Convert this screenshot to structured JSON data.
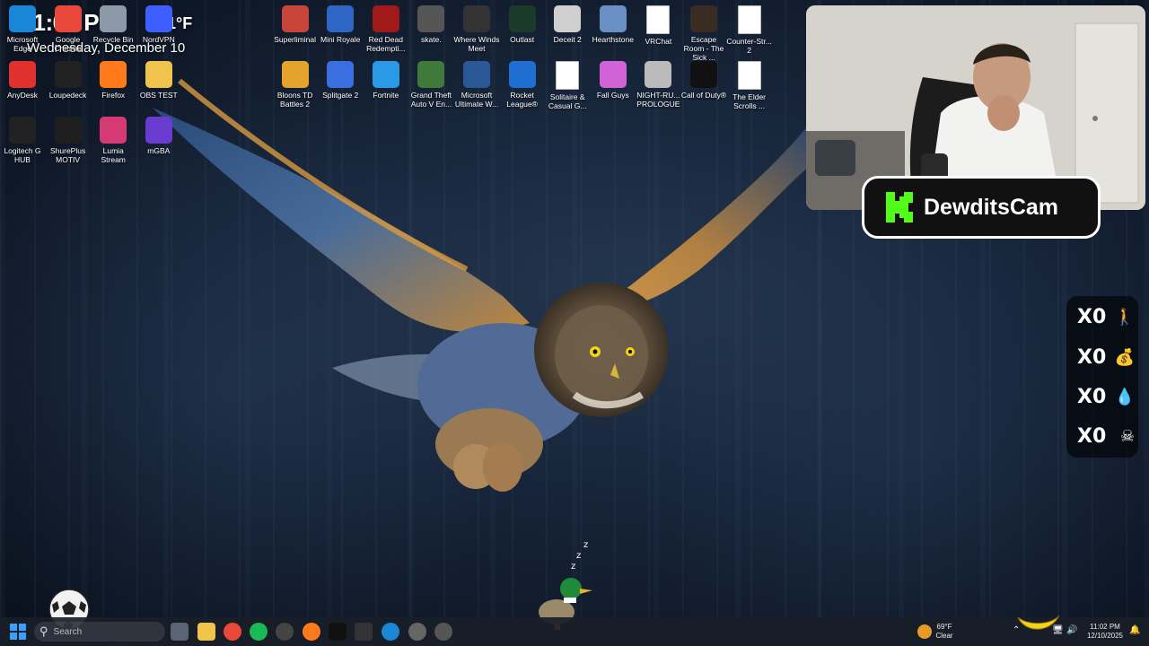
{
  "widget": {
    "time": "11:02 PM",
    "temperature": "51°F",
    "date": "Wednesday, December 10"
  },
  "desktop_icons": [
    {
      "label": "Microsoft Edge",
      "icon": "edge-icon",
      "color": "#1a86d8"
    },
    {
      "label": "Google Chrome",
      "icon": "chrome-icon",
      "color": "#e9483a"
    },
    {
      "label": "Recycle Bin",
      "icon": "recycle-bin-icon",
      "color": "#8c9aa8"
    },
    {
      "label": "NordVPN",
      "icon": "nordvpn-icon",
      "color": "#3e5fff"
    },
    {
      "label": "Superliminal",
      "icon": "superliminal-icon",
      "color": "#c8453c"
    },
    {
      "label": "Mini Royale",
      "icon": "mini-royale-icon",
      "color": "#2f66c6"
    },
    {
      "label": "Red Dead Redempti...",
      "icon": "red-dead-icon",
      "color": "#a01a1a"
    },
    {
      "label": "skate.",
      "icon": "skate-icon",
      "color": "#555555"
    },
    {
      "label": "Where Winds Meet",
      "icon": "where-winds-meet-icon",
      "color": "#333333"
    },
    {
      "label": "Outlast",
      "icon": "outlast-icon",
      "color": "#1b3b2a"
    },
    {
      "label": "Deceit 2",
      "icon": "deceit-icon",
      "color": "#cfcfcf"
    },
    {
      "label": "Hearthstone",
      "icon": "hearthstone-icon",
      "color": "#6a8fc2"
    },
    {
      "label": "VRChat",
      "icon": "file-icon",
      "color": "#ffffff"
    },
    {
      "label": "Escape Room - The Sick ...",
      "icon": "escape-room-icon",
      "color": "#3a2b23"
    },
    {
      "label": "Counter-Str... 2",
      "icon": "file-icon",
      "color": "#ffffff"
    },
    {
      "label": "AnyDesk",
      "icon": "anydesk-icon",
      "color": "#e1312f"
    },
    {
      "label": "Loupedeck",
      "icon": "loupedeck-icon",
      "color": "#222222"
    },
    {
      "label": "Firefox",
      "icon": "firefox-icon",
      "color": "#ff7a1a"
    },
    {
      "label": "OBS TEST",
      "icon": "folder-icon",
      "color": "#f0c34d"
    },
    {
      "label": "Bloons TD Battles 2",
      "icon": "bloons-icon",
      "color": "#e3a32c"
    },
    {
      "label": "Splitgate 2",
      "icon": "splitgate-icon",
      "color": "#3b6fe0"
    },
    {
      "label": "Fortnite",
      "icon": "fortnite-icon",
      "color": "#2a9ae6"
    },
    {
      "label": "Grand Theft Auto V En...",
      "icon": "gta-icon",
      "color": "#3f7a3a"
    },
    {
      "label": "Microsoft Ultimate W...",
      "icon": "microsoft-word-icon",
      "color": "#2b5796"
    },
    {
      "label": "Rocket League®",
      "icon": "rocket-league-icon",
      "color": "#1e6fd1"
    },
    {
      "label": "Solitaire & Casual G...",
      "icon": "file-icon",
      "color": "#ffffff"
    },
    {
      "label": "Fall Guys",
      "icon": "fall-guys-icon",
      "color": "#d064d6"
    },
    {
      "label": "NIGHT-RU... PROLOGUE",
      "icon": "night-run-icon",
      "color": "#bbbbbb"
    },
    {
      "label": "Call of Duty®",
      "icon": "call-of-duty-icon",
      "color": "#111111"
    },
    {
      "label": "The Elder Scrolls ...",
      "icon": "file-icon",
      "color": "#ffffff"
    },
    {
      "label": "Logitech G HUB",
      "icon": "logitech-icon",
      "color": "#222222"
    },
    {
      "label": "ShurePlus MOTIV",
      "icon": "shure-icon",
      "color": "#1f1f1f"
    },
    {
      "label": "Lumia Stream",
      "icon": "lumia-icon",
      "color": "#d63a74"
    },
    {
      "label": "mGBA",
      "icon": "mgba-icon",
      "color": "#6a3bd1"
    }
  ],
  "webcam": {
    "badge_name": "DewditsCam",
    "accent": "#53fc18"
  },
  "counters": [
    {
      "value": "X0",
      "icon": "person-icon"
    },
    {
      "value": "X0",
      "icon": "money-bag-icon"
    },
    {
      "value": "X0",
      "icon": "droplets-icon"
    },
    {
      "value": "X0",
      "icon": "skull-icon"
    }
  ],
  "taskbar": {
    "search_placeholder": "Search",
    "weather_temp": "69°F",
    "weather_desc": "Clear",
    "time": "11:02 PM",
    "date": "12/10/2025"
  }
}
